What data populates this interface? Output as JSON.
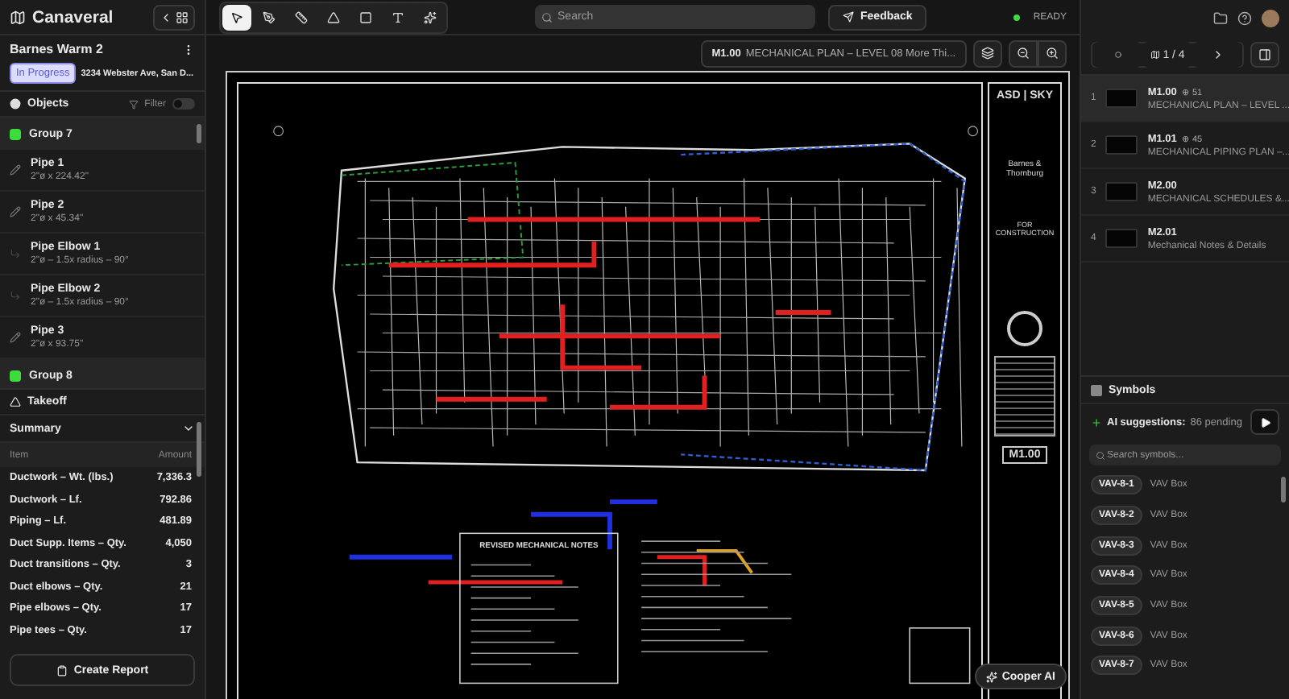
{
  "app": {
    "name": "Canaveral"
  },
  "tools": [
    {
      "kind": "select",
      "selected": true
    },
    {
      "kind": "measure",
      "selected": false
    },
    {
      "kind": "ruler",
      "selected": false
    },
    {
      "kind": "count",
      "selected": false
    },
    {
      "kind": "area",
      "selected": false
    },
    {
      "kind": "text",
      "selected": false
    },
    {
      "kind": "ai",
      "selected": false
    }
  ],
  "search": {
    "placeholder": "Search"
  },
  "feedback": "Feedback",
  "status": "READY",
  "project": {
    "title": "Barnes Warm 2",
    "status": "In Progress",
    "address": "3234 Webster Ave, San D..."
  },
  "objects": {
    "title": "Objects",
    "filter": "Filter",
    "filter_on": false,
    "items": [
      {
        "kind": "group",
        "name": "Group 7",
        "color": "#3ddc3d"
      },
      {
        "kind": "pipe",
        "name": "Pipe 1",
        "detail": "2\"ø x 224.42\""
      },
      {
        "kind": "pipe",
        "name": "Pipe 2",
        "detail": "2\"ø x 45.34\""
      },
      {
        "kind": "elbow",
        "name": "Pipe Elbow 1",
        "detail": "2\"ø – 1.5x radius – 90°"
      },
      {
        "kind": "elbow",
        "name": "Pipe Elbow 2",
        "detail": "2\"ø – 1.5x radius – 90°"
      },
      {
        "kind": "pipe",
        "name": "Pipe 3",
        "detail": "2\"ø x 93.75\""
      },
      {
        "kind": "group",
        "name": "Group 8",
        "color": "#3ddc3d"
      }
    ]
  },
  "takeoff": {
    "title": "Takeoff",
    "summary": "Summary",
    "columns": [
      "Item",
      "Amount"
    ],
    "rows": [
      [
        "Ductwork – Wt. (lbs.)",
        "7,336.3"
      ],
      [
        "Ductwork – Lf.",
        "792.86"
      ],
      [
        "Piping – Lf.",
        "481.89"
      ],
      [
        "Duct Supp. Items – Qty.",
        "4,050"
      ],
      [
        "Duct transitions – Qty.",
        "3"
      ],
      [
        "Duct elbows – Qty.",
        "21"
      ],
      [
        "Pipe elbows – Qty.",
        "17"
      ],
      [
        "Pipe tees – Qty.",
        "17"
      ]
    ]
  },
  "create_report": "Create Report",
  "sheet_header": {
    "number": "M1.00",
    "title": "MECHANICAL PLAN – LEVEL 08 More Thi..."
  },
  "sheet": {
    "brand": "ASD | SKY",
    "client": "Barnes & Thornburg",
    "stamp": "FOR CONSTRUCTION",
    "number": "M1.00",
    "notes_title": "REVISED MECHANICAL NOTES"
  },
  "cooper": "Cooper AI",
  "pager": "1 / 4",
  "sheets": [
    {
      "index": "1",
      "number": "M1.00",
      "count": "⊕ 51",
      "title": "MECHANICAL PLAN – LEVEL ...",
      "selected": true
    },
    {
      "index": "2",
      "number": "M1.01",
      "count": "⊕ 45",
      "title": "MECHANICAL PIPING PLAN –...",
      "selected": false
    },
    {
      "index": "3",
      "number": "M2.00",
      "title": "MECHANICAL SCHEDULES &...",
      "selected": false
    },
    {
      "index": "4",
      "number": "M2.01",
      "title": "Mechanical Notes & Details",
      "selected": false
    }
  ],
  "symbols": {
    "title": "Symbols",
    "ai_label": "AI suggestions:",
    "ai_pending": "86 pending",
    "placeholder": "Search symbols...",
    "items": [
      {
        "tag": "VAV-8-1",
        "label": "VAV Box"
      },
      {
        "tag": "VAV-8-2",
        "label": "VAV Box"
      },
      {
        "tag": "VAV-8-3",
        "label": "VAV Box"
      },
      {
        "tag": "VAV-8-4",
        "label": "VAV Box"
      },
      {
        "tag": "VAV-8-5",
        "label": "VAV Box"
      },
      {
        "tag": "VAV-8-6",
        "label": "VAV Box"
      },
      {
        "tag": "VAV-8-7",
        "label": "VAV Box"
      }
    ]
  }
}
